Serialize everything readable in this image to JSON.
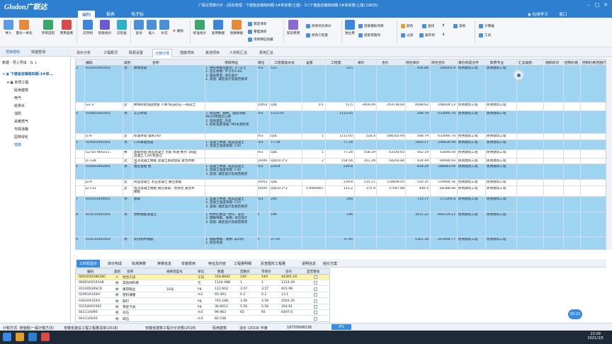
{
  "app": {
    "logo": "Glodon广联达",
    "window_title": "广联达预算计价 - [投标管理 - 下塘金店镇南四期-1#单体楼(土建) - D:/下塘金店镇南四期-1#单体楼(土建).GBQ5]",
    "login_label": "在线学习",
    "window_label": "窗口"
  },
  "menu": [
    "编制",
    "报表",
    "电子标"
  ],
  "ribbon": {
    "buttons": [
      "导入",
      "量价一体化",
      "项目自检",
      "费用查看",
      "云存档",
      "智能组价",
      "云检查",
      "查询",
      "插入",
      "补充",
      "删除",
      "标准组价",
      "复用数据",
      "替换数据",
      "锁定清单",
      "安装费用",
      "独立费",
      "颜色",
      "查找",
      "过滤",
      "展开到",
      "其他",
      "计算器",
      "工具"
    ],
    "small": [
      "锁定清单",
      "整理清单",
      "项目特征隐藏",
      "修改综合单价",
      "修改工程量",
      "提取模板项目",
      "提取措施项",
      "插入清单"
    ]
  },
  "left_tabs": [
    "项目结构",
    "快速查询"
  ],
  "tree": {
    "toolbar": "新建 · 导入导出 · ⇅ ↓",
    "root": "下塘金店镇南四期-1#单...",
    "items": [
      "单项工程",
      "民用建筑",
      "电气",
      "给排水",
      "消防",
      "采暖燃气",
      "市政道路",
      "园林绿化",
      "措施"
    ]
  },
  "tabs": [
    "造价分析",
    "工程概况",
    "取费设置",
    "分部分项",
    "措施项目",
    "其他项目",
    "人材机汇总",
    "费用汇总"
  ],
  "grid": {
    "headers": [
      "编码",
      "类别",
      "名称",
      "项目特征",
      "单位",
      "工程量表达式",
      "含量",
      "工程量",
      "单价",
      "合价",
      "综合单价",
      "综合合价",
      "单价构成文件",
      "取费专业",
      "汇总类别",
      "指标标识",
      "控制价格",
      "控制价格范围(%)"
    ],
    "rows": [
      {
        "no": "3",
        "code": "010201001001",
        "cat": "项",
        "name": "换填垫层",
        "feature": "1. 材料种类及配比: 3:7灰土\n2. 压实系数: 不小于0.94\n3. 铺设厚度: 详见设计\n4. 其他: 满足设计及规范要求",
        "unit": "m3",
        "expr": "515",
        "qty_rate": "",
        "qty": "515",
        "price": "",
        "total": "",
        "comp_price": "404.86",
        "comp_total": "208502.9",
        "file": "民用建筑工程",
        "major": "民用建筑工程"
      },
      {
        "no": "",
        "code": "G2-3",
        "cat": "定",
        "name": "换填砂砾加固地基 人填 机压砂石 一般软土",
        "feature": "",
        "unit": "10m3",
        "expr": "QDL",
        "qty_rate": "0.1",
        "qty": "51.5",
        "price": "3956.09",
        "total": "203738.64",
        "comp_price": "4048.62",
        "comp_total": "208504.23",
        "file": "民用建筑工程",
        "major": "民用建筑工程"
      },
      {
        "no": "4",
        "code": "010401001001",
        "cat": "项",
        "name": "实心砖墙",
        "feature": "1. 砖品种、规格、强度等级: MU10页岩实心砖\n2. 墙体类型: 外墙\n3. 砂浆强度等级: M5水泥砂浆",
        "unit": "m3",
        "expr": "1113.05",
        "qty_rate": "",
        "qty": "1113.05",
        "price": "",
        "total": "",
        "comp_price": "568.79",
        "comp_total": "633046.74",
        "file": "民用建筑工程",
        "major": "民用建筑工程"
      },
      {
        "no": "",
        "code": "J1-6",
        "cat": "定",
        "name": "标准砖墙 墙厚240",
        "feature": "",
        "unit": "m3",
        "expr": "QDL",
        "qty_rate": "1",
        "qty": "1113.05",
        "price": "524.4",
        "total": "584102.94",
        "comp_price": "568.79",
        "comp_total": "633046.74",
        "file": "民用建筑工程",
        "major": "民用建筑工程"
      },
      {
        "no": "5",
        "code": "010501001001",
        "cat": "项",
        "name": "C20基础垫层",
        "feature": "1. 混凝土种类: 商品混凝土\n2. 混凝土强度等级: C20",
        "unit": "m3",
        "expr": "77.28",
        "qty_rate": "",
        "qty": "77.28",
        "price": "",
        "total": "",
        "comp_price": "1403.17",
        "comp_total": "108436.98",
        "file": "民用建筑工程",
        "major": "民用建筑工程"
      },
      {
        "no": "",
        "code": "G2-83 H00211...",
        "cat": "换",
        "name": "基础垫层 商品混凝土 无筋 泵送 换为【商品混凝土 C20(泵送)】",
        "feature": "",
        "unit": "m3",
        "expr": "QDL",
        "qty_rate": "1",
        "qty": "77.28",
        "price": "558.29",
        "total": "43144.65",
        "comp_price": "562.19",
        "comp_total": "43446.04",
        "file": "民用建筑工程",
        "major": "民用建筑工程"
      },
      {
        "no": "",
        "code": "J1-128",
        "cat": "定",
        "name": "现浇混凝土模板 混凝土基础垫层 复合木模板",
        "feature": "",
        "unit": "100m2",
        "expr": "QDL/0.1*2",
        "qty_rate": "2",
        "qty": "154.56",
        "price": "351.26",
        "total": "54293.84",
        "comp_price": "420.49",
        "comp_total": "64990.93",
        "file": "民用建筑工程",
        "major": "民用建筑工程"
      },
      {
        "no": "6",
        "code": "010501003001",
        "cat": "项",
        "name": "独立基础 柱",
        "feature": "1. 混凝土种类: 商品混凝土\n2. 混凝土强度等级: C30\n3. 其他: 满足设计及规范要求",
        "unit": "m3",
        "expr": "229.8",
        "qty_rate": "",
        "qty": "229.8",
        "price": "",
        "total": "",
        "comp_price": "818.29",
        "comp_total": "188043.04",
        "file": "民用建筑工程",
        "major": "民用建筑工程"
      },
      {
        "no": "",
        "code": "J2-4",
        "cat": "定",
        "name": "商品混凝土 毛石混凝土 独立基础",
        "feature": "",
        "unit": "10m3",
        "expr": "QDL",
        "qty_rate": "",
        "qty": "229.8",
        "price": "515.27",
        "total": "118409.05",
        "comp_price": "520.35",
        "comp_total": "119064.56",
        "file": "民用建筑工程",
        "major": "民用建筑工程"
      },
      {
        "no": "",
        "code": "J2-131",
        "cat": "定",
        "name": "现浇混凝土模板 独立基础、柱承台 复合木模板",
        "feature": "",
        "unit": "100m2",
        "expr": "QDL/0.2*2",
        "qty_rate": "0.6666667",
        "qty": "153.2",
        "price": "375.9",
        "total": "57587.88",
        "comp_price": "446.4",
        "comp_total": "68388.48",
        "file": "民用建筑工程",
        "major": "民用建筑工程"
      },
      {
        "no": "7",
        "code": "010503004001",
        "cat": "项",
        "name": "圈梁",
        "feature": "1. 混凝土种类: 商品混凝土\n2. 混凝土强度等级: C25\n3. 其他: 满足设计及规范要求",
        "unit": "m3",
        "expr": "240",
        "qty_rate": "",
        "qty": "240",
        "price": "",
        "total": "",
        "comp_price": "713.77",
        "comp_total": "171304.8",
        "file": "民用建筑工程",
        "major": "民用建筑工程"
      },
      {
        "no": "8",
        "code": "010515001001",
        "cat": "项",
        "name": "预制钢筋混凝土",
        "feature": "1. 构件的类型: 制作、安装\n2. 钢筋种类、规格: 详见设计\n3. 其他: 满足设计及规范要求",
        "unit": "t",
        "expr": "196",
        "qty_rate": "",
        "qty": "196",
        "price": "",
        "total": "",
        "comp_price": "3531.22",
        "comp_total": "692119.12",
        "file": "民用建筑工程",
        "major": "民用建筑工程"
      },
      {
        "no": "9",
        "code": "010515001002",
        "cat": "项",
        "name": "现浇构件钢筋",
        "feature": "1. 钢筋种类、规格: φ10内\n2. 综合考虑",
        "unit": "t",
        "expr": "37.95",
        "qty_rate": "",
        "qty": "37.95",
        "price": "",
        "total": "",
        "comp_price": "5362.34",
        "comp_total": "203494.77",
        "file": "民用建筑工程",
        "major": "民用建筑工程"
      }
    ]
  },
  "bottom_tabs": [
    "工料机显示",
    "单价构成",
    "标准换算",
    "换算信息",
    "安装费用",
    "特征及内容",
    "工程量明细",
    "反查图形工程量",
    "说明信息",
    "组价方案"
  ],
  "bottom_grid": {
    "headers": [
      "编码",
      "类别",
      "名称",
      "规格及型号",
      "单位",
      "数量",
      "定额价",
      "市场价",
      "合价",
      "是否暂估"
    ],
    "rows": [
      {
        "code": "00010101801BC",
        "cat": "人",
        "name": "综合工日",
        "spec": "",
        "unit": "工日",
        "qty": "316.8942",
        "price": "140",
        "market": "140",
        "total": "44365.19"
      },
      {
        "code": "00001A0101A8",
        "cat": "材",
        "name": "其他材料费",
        "spec": "",
        "unit": "元",
        "qty": "1124.488",
        "price": "1",
        "market": "1",
        "total": "1124.49"
      },
      {
        "code": "01030030SCD",
        "cat": "材",
        "name": "镀锌铁丝",
        "spec": "16号",
        "unit": "kg",
        "qty": "112.602",
        "price": "3.57",
        "market": "3.57",
        "total": "401.99"
      },
      {
        "code": "02091A150H",
        "cat": "材",
        "name": "塑料薄膜",
        "spec": "",
        "unit": "m2",
        "qty": "65.493",
        "price": "0.2",
        "market": "0.2",
        "total": "13.1"
      },
      {
        "code": "03010A150H",
        "cat": "材",
        "name": "铁钉",
        "spec": "",
        "unit": "kg",
        "qty": "703.188",
        "price": "3.56",
        "market": "3.56",
        "total": "2503.35"
      },
      {
        "code": "03154A0150C",
        "cat": "材",
        "name": "零星卡具",
        "spec": "",
        "unit": "kg",
        "qty": "36.8012",
        "price": "5.56",
        "market": "5.56",
        "total": "204.61"
      },
      {
        "code": "04111A090",
        "cat": "材",
        "name": "对石",
        "spec": "",
        "unit": "m3",
        "qty": "99.963",
        "price": "65",
        "market": "65",
        "total": "6497.6"
      },
      {
        "code": "04111A030",
        "cat": "材",
        "name": "碎石",
        "spec": "",
        "unit": "m3",
        "qty": "82.538",
        "price": "",
        "market": "",
        "total": ""
      }
    ]
  },
  "status": {
    "method": "计税方式: 增值税(一般计税方法)",
    "std1": "安徽省建设工程工程量清单(2018)",
    "std2": "安徽省建筑工程计价定额(2018)",
    "major": "民用建筑",
    "price_doc": "造价 (2019) 字第",
    "phone": "18705698238",
    "zoom": "0%"
  },
  "timer": "00:22",
  "clock": {
    "time": "22:09",
    "date": "2021/3/5"
  }
}
